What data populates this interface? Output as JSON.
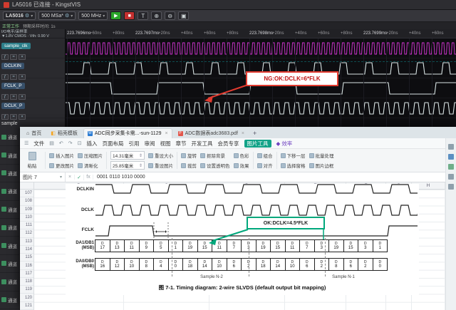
{
  "icons": {
    "gear": "⚙",
    "caret": "▾",
    "home": "⌂",
    "docer": "◧",
    "hamburger": "☰",
    "save": "▤",
    "undo": "↶",
    "redo": "↷",
    "print": "⊡",
    "stepper": "⇕",
    "diamond": "◆"
  },
  "la": {
    "title": "LA5016 已连接 - KingstVIS",
    "toolbar": {
      "device": "LA5016",
      "sample_rate": "500 MSa*",
      "bandwidth": "500 MHz",
      "play": "▶",
      "stop": "■",
      "trigger": "T",
      "zoom_in": "⊕",
      "zoom_out": "⊖",
      "zoom_fit": "▣"
    },
    "status": {
      "state": "正常工作",
      "expected": "预期采样时间: 1s"
    },
    "panel": {
      "io_label": "I/O电平/采样率",
      "threshold": "▼1.8V CMOS · Vth: 0.90 V"
    },
    "channels": [
      {
        "name": "sample_clk",
        "tag_color": "#2e7f8a",
        "wave": {
          "color": "#c832c8",
          "period": 7,
          "duty": 0.5,
          "start": "low",
          "slant": 1,
          "width": 1
        }
      },
      {
        "name": "DCLKIN",
        "tag_color": "#37506a",
        "wave": {
          "color": "#d9e4e4",
          "period": 36,
          "duty": 0.28,
          "start": "low",
          "slant": 2,
          "width": 1.1
        }
      },
      {
        "name": "FCLK_P",
        "tag_color": "#37506a",
        "wave": {
          "color": "#d9e4e4",
          "period": 130,
          "duty": 0.5,
          "start": "high",
          "slant": 2,
          "width": 1.1
        }
      },
      {
        "name": "DCLK_P",
        "tag_color": "#37506a",
        "wave": {
          "color": "#d9e4e4",
          "period": 14,
          "duty": 0.5,
          "start": "high",
          "slant": 2,
          "width": 1.1
        }
      }
    ],
    "channel_icon_names": [
      "function-icon",
      "waveform-icon",
      "clear-icon"
    ],
    "ruler_ticks": [
      "223.7696ms",
      "+60ns",
      "+80ns",
      "223.7697ms",
      "+20ns",
      "+40ns",
      "+60ns",
      "+80ns",
      "223.7698ms",
      "+20ns",
      "+40ns",
      "+60ns",
      "+80ns",
      "223.7699ms",
      "+20ns",
      "+40ns",
      "+60ns"
    ],
    "annotation": {
      "text": "NG:OK:DCLK=6*FLK"
    },
    "strip": {
      "partial": "sample",
      "cell": "通道",
      "count": 10
    }
  },
  "wps": {
    "tabs": {
      "home": "首页",
      "docer": "稻壳模板",
      "new_tab": "+",
      "docs": [
        {
          "label": "ADC同步采集卡需...-sun-1129",
          "icon_letter": "W",
          "icon_color": "#2b7cd3",
          "close": "×"
        },
        {
          "label": "ADC数据表adc3683.pdf",
          "icon_letter": "P",
          "icon_color": "#e2574c",
          "close": "×"
        }
      ]
    },
    "menu": {
      "file": "文件",
      "items": [
        "插入",
        "页面布局",
        "引用",
        "审阅",
        "视图",
        "章节",
        "开发工具",
        "会员专享"
      ],
      "picture_tools": "图片工具",
      "efficiency": "效率"
    },
    "ribbon": {
      "paste": "粘贴",
      "pairs": [
        {
          "top": "插入图片",
          "bottom": "更改图片"
        },
        {
          "top": "压缩图片",
          "bottom": "清晰化"
        },
        {
          "fields": true,
          "top": "14.31毫米",
          "bottom": "25.85毫米"
        },
        {
          "top": "重设大小",
          "bottom": "重设图片"
        },
        {
          "top": "旋转",
          "bottom": "裁剪"
        },
        {
          "top": "抠除背景",
          "bottom": "设置透明色"
        },
        {
          "top": "色彩",
          "bottom": "效果"
        },
        {
          "top": "组合",
          "bottom": "对齐"
        },
        {
          "top": "下移一层",
          "bottom": "选择窗格"
        },
        {
          "top": "批量处理",
          "bottom": "图片边框"
        }
      ]
    },
    "formula": {
      "name_box": "图片 7",
      "cancel": "×",
      "enter": "✓",
      "fx": "fx",
      "content": "0001 0110 1010 0000"
    },
    "grid": {
      "rows": [
        "107",
        "108",
        "109",
        "110",
        "111",
        "112",
        "113",
        "114",
        "115",
        "116",
        "117",
        "118",
        "119",
        "120",
        "121"
      ],
      "cols": [
        "B",
        "C",
        "D",
        "E",
        "F",
        "G",
        "H"
      ]
    },
    "diagram": {
      "labels": {
        "dclkin": "DCLKIN",
        "dclk": "DCLK",
        "fclk": "FCLK",
        "lane1": "DA1/DB1",
        "lane1_sub": "(MSB)",
        "lane0": "DA0/DB0",
        "lane0_sub": "(MSB)"
      },
      "note": "OK:DCLK=4.5*FLK",
      "lane1_bits": [
        "D17",
        "D13",
        "D11",
        "D9",
        "D5",
        "D1",
        "D19",
        "D15",
        "D11",
        "D7",
        "D3",
        "D19",
        "D15",
        "D11",
        "D7",
        "D3",
        "D19",
        "D15",
        "D3",
        "D1"
      ],
      "lane0_bits": [
        "D16",
        "D12",
        "D10",
        "D8",
        "D4",
        "D0",
        "D18",
        "D14",
        "D10",
        "D6",
        "D2",
        "D18",
        "D14",
        "D10",
        "D6",
        "D2",
        "D8",
        "D6",
        "D2",
        "D0"
      ],
      "samples": [
        "Sample N-2",
        "Sample N-1"
      ],
      "caption": "图 7-1. Timing diagram: 2-wire SLVDS (default output bit mapping)"
    }
  }
}
